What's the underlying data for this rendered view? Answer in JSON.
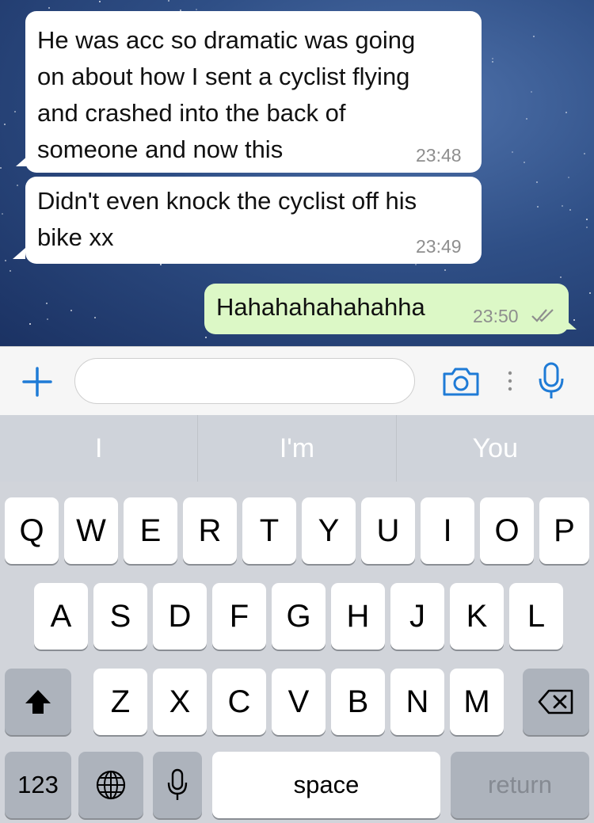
{
  "messages": [
    {
      "direction": "incoming",
      "lines": [
        "He was acc so dramatic was going",
        "on about how I sent a cyclist flying",
        "and crashed into the back of",
        "someone and now this"
      ],
      "time": "23:48"
    },
    {
      "direction": "incoming",
      "lines": [
        "Didn't even knock the cyclist off his",
        "bike xx"
      ],
      "time": "23:49"
    },
    {
      "direction": "outgoing",
      "lines": [
        "Hahahahahahahha"
      ],
      "time": "23:50",
      "status": "read-double-check-icon"
    }
  ],
  "input_bar": {
    "add_icon": "plus-icon",
    "text_value": "",
    "camera_icon": "camera-icon",
    "mic_icon": "microphone-icon",
    "accent": "#1f7bd6"
  },
  "suggestions": [
    "I",
    "I'm",
    "You"
  ],
  "keyboard": {
    "row1": [
      "Q",
      "W",
      "E",
      "R",
      "T",
      "Y",
      "U",
      "I",
      "O",
      "P"
    ],
    "row2": [
      "A",
      "S",
      "D",
      "F",
      "G",
      "H",
      "J",
      "K",
      "L"
    ],
    "row3": [
      "Z",
      "X",
      "C",
      "V",
      "B",
      "N",
      "M"
    ],
    "shift_icon": "shift-icon",
    "backspace_icon": "backspace-icon",
    "numbers_label": "123",
    "globe_icon": "globe-icon",
    "dictation_icon": "microphone-icon",
    "space_label": "space",
    "return_label": "return"
  }
}
